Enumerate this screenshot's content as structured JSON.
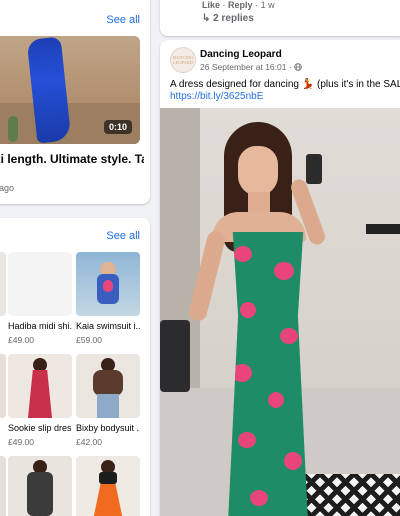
{
  "video_section": {
    "see_all": "See all",
    "duration": "0:10",
    "caption": "xi length. Ultimate style. Ta...",
    "time_ago": "s ago"
  },
  "shop_section": {
    "see_all": "See all",
    "products": [
      {
        "name": "",
        "price": ""
      },
      {
        "name": "Hadiba midi shi...",
        "price": "£49.00"
      },
      {
        "name": "Kaia swimsuit i...",
        "price": "£59.00"
      },
      {
        "name": "",
        "price": ""
      },
      {
        "name": "Sookie slip dres...",
        "price": "£49.00"
      },
      {
        "name": "Bixby bodysuit ...",
        "price": "£42.00"
      },
      {
        "name": "",
        "price": ""
      },
      {
        "name": "",
        "price": ""
      },
      {
        "name": "",
        "price": ""
      }
    ]
  },
  "comment": {
    "like": "Like",
    "separator": "·",
    "reply": "Reply",
    "time": "1 w",
    "replies": "2 replies"
  },
  "post": {
    "page_name": "Dancing Leopard",
    "avatar_text": "DANCING LEOPARD",
    "timestamp": "26 September at 16:01 · ",
    "globe_icon": "globe-icon",
    "text": "A dress designed for dancing 💃 (plus it's in the SALE!)",
    "link": "https://bit.ly/3625nbE"
  }
}
